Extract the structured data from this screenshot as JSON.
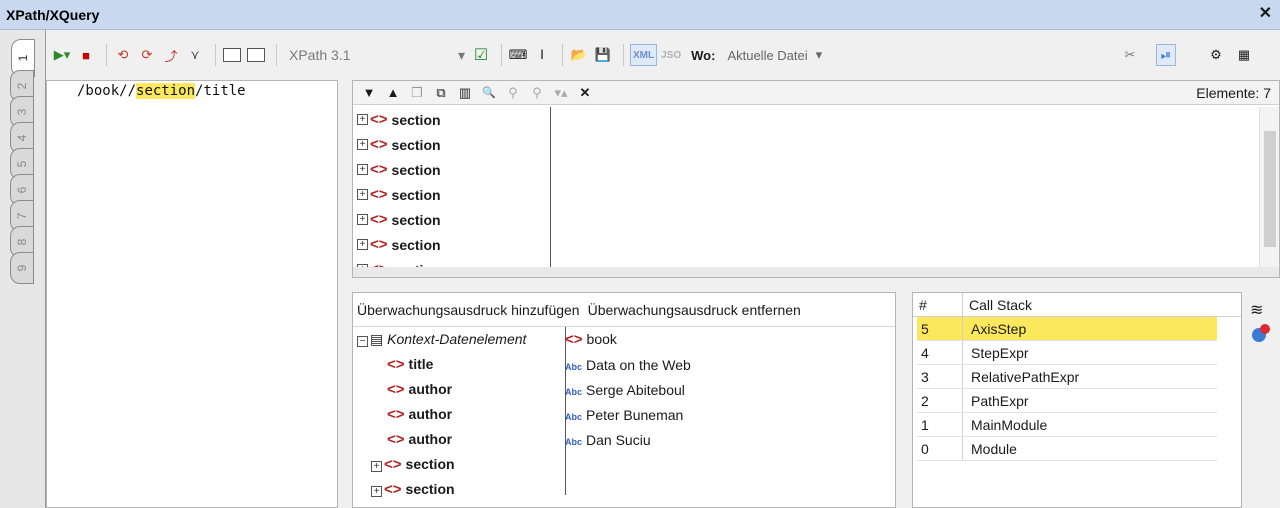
{
  "window": {
    "title": "XPath/XQuery"
  },
  "tabs": [
    "1",
    "2",
    "3",
    "4",
    "5",
    "6",
    "7",
    "8",
    "9"
  ],
  "toolbar": {
    "version": "XPath 3.1",
    "xml_label": "XML",
    "json_label": "JSO",
    "wo_label": "Wo:",
    "scope": "Aktuelle Datei"
  },
  "expression": {
    "before": "/book//",
    "highlight": "section",
    "after": "/title"
  },
  "results": {
    "count_label": "Elemente: 7",
    "rows": [
      "section",
      "section",
      "section",
      "section",
      "section",
      "section",
      "section"
    ]
  },
  "watch": {
    "add_label": "Überwachungsausdruck hinzufügen",
    "remove_label": "Überwachungsausdruck entfernen",
    "context_label": "Kontext-Datenelement",
    "context_value": "book",
    "items": [
      {
        "name": "title",
        "value": "Data on the Web"
      },
      {
        "name": "author",
        "value": "Serge Abiteboul"
      },
      {
        "name": "author",
        "value": "Peter Buneman"
      },
      {
        "name": "author",
        "value": "Dan Suciu"
      },
      {
        "name": "section",
        "value": ""
      },
      {
        "name": "section",
        "value": ""
      }
    ]
  },
  "callstack": {
    "col_num": "#",
    "col_name": "Call Stack",
    "rows": [
      {
        "n": "5",
        "name": "AxisStep"
      },
      {
        "n": "4",
        "name": "StepExpr"
      },
      {
        "n": "3",
        "name": "RelativePathExpr"
      },
      {
        "n": "2",
        "name": "PathExpr"
      },
      {
        "n": "1",
        "name": "MainModule"
      },
      {
        "n": "0",
        "name": "Module"
      }
    ]
  },
  "colors": {
    "highlight": "#fce85d",
    "titlebar": "#c8d8ef",
    "tag": "#b22222"
  }
}
